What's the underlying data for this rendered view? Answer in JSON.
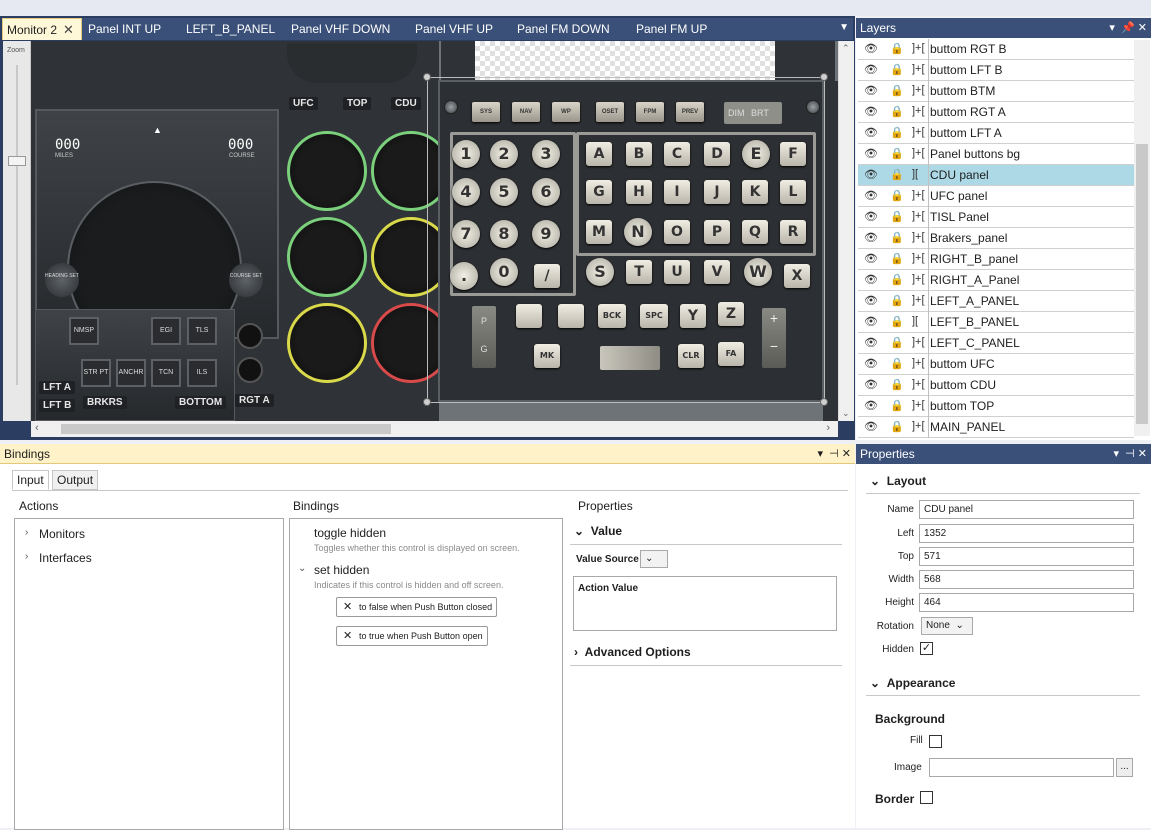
{
  "doc_tabs": {
    "monitor2": "Monitor 2",
    "panel_int_up": "Panel INT UP",
    "left_b_panel": "LEFT_B_PANEL",
    "panel_vhf_down": "Panel VHF DOWN",
    "panel_vhf_up": "Panel VHF UP",
    "panel_fm_down": "Panel FM DOWN",
    "panel_fm_up": "Panel FM UP"
  },
  "canvas": {
    "zoom_label": "Zoom",
    "panel_labels": {
      "ufc": "UFC",
      "top": "TOP",
      "cdu": "CDU",
      "lft_a": "LFT A",
      "lft_b": "LFT B",
      "brkrs": "BRKRS",
      "bottom": "BOTTOM",
      "rgt_a": "RGT A"
    },
    "cdu": {
      "function_keys": [
        "SYS",
        "NAV",
        "WP",
        "OSET",
        "FPM",
        "PREV"
      ],
      "dim": "DIM",
      "brt": "BRT",
      "digits": [
        "1",
        "2",
        "3",
        "4",
        "5",
        "6",
        "7",
        "8",
        "9",
        ".",
        "0",
        "/"
      ],
      "letters_row1": [
        "A",
        "B",
        "C",
        "D",
        "E",
        "F"
      ],
      "letters_row2": [
        "G",
        "H",
        "I",
        "J",
        "K",
        "L"
      ],
      "letters_row3": [
        "M",
        "N",
        "O",
        "P",
        "Q",
        "R"
      ],
      "letters_row4": [
        "S",
        "T",
        "U",
        "V",
        "W",
        "X"
      ],
      "bottom_keys": [
        "BCK",
        "SPC",
        "Y",
        "Z"
      ],
      "mk": "MK",
      "clr": "CLR",
      "fa": "FA",
      "plus": "+",
      "minus": "−",
      "p": "P",
      "g": "G"
    },
    "lft_buttons": [
      "NMSP",
      "EGI",
      "TLS",
      "STR PT",
      "ANCHR",
      "TCN",
      "ILS"
    ],
    "hsi": {
      "miles": "000",
      "course": "000",
      "miles_label": "MILES",
      "course_label": "COURSE",
      "heading_set": "HEADING SET",
      "course_set": "COURSE SET"
    }
  },
  "layers": {
    "title": "Layers",
    "items": [
      {
        "name": "buttom  RGT B",
        "selected": false
      },
      {
        "name": "buttom LFT B",
        "selected": false
      },
      {
        "name": "buttom BTM",
        "selected": false
      },
      {
        "name": "buttom  RGT A",
        "selected": false
      },
      {
        "name": "buttom LFT A",
        "selected": false
      },
      {
        "name": "Panel buttons bg",
        "selected": false
      },
      {
        "name": "CDU panel",
        "selected": true
      },
      {
        "name": "UFC panel",
        "selected": false
      },
      {
        "name": "TISL Panel",
        "selected": false
      },
      {
        "name": "Brakers_panel",
        "selected": false
      },
      {
        "name": "RIGHT_B_panel",
        "selected": false
      },
      {
        "name": "RIGHT_A_Panel",
        "selected": false
      },
      {
        "name": "LEFT_A_PANEL",
        "selected": false
      },
      {
        "name": "LEFT_B_PANEL",
        "selected": false
      },
      {
        "name": "LEFT_C_PANEL",
        "selected": false
      },
      {
        "name": "buttom UFC",
        "selected": false
      },
      {
        "name": "buttom CDU",
        "selected": false
      },
      {
        "name": "buttom TOP",
        "selected": false
      },
      {
        "name": "MAIN_PANEL",
        "selected": false
      }
    ]
  },
  "bindings": {
    "title": "Bindings",
    "tab_input": "Input",
    "tab_output": "Output",
    "col_actions": "Actions",
    "col_bindings": "Bindings",
    "col_properties": "Properties",
    "actions": [
      "Monitors",
      "Interfaces"
    ],
    "toggle_hidden": "toggle hidden",
    "toggle_hidden_desc": "Toggles whether this control is displayed on screen.",
    "set_hidden": "set hidden",
    "set_hidden_desc": "Indicates if this control is hidden and off screen.",
    "chip1": "to false when Push Button closed",
    "chip2": "to true when Push Button open",
    "value_section": "Value",
    "value_source": "Value Source",
    "action_value": "Action Value",
    "advanced_options": "Advanced Options"
  },
  "properties": {
    "title": "Properties",
    "layout": "Layout",
    "name_label": "Name",
    "name": "CDU panel",
    "left_label": "Left",
    "left": "1352",
    "top_label": "Top",
    "top": "571",
    "width_label": "Width",
    "width": "568",
    "height_label": "Height",
    "height": "464",
    "rotation_label": "Rotation",
    "rotation": "None",
    "hidden_label": "Hidden",
    "hidden": true,
    "appearance": "Appearance",
    "background": "Background",
    "fill_label": "Fill",
    "image_label": "Image",
    "browse": "...",
    "border": "Border"
  },
  "colors": {
    "chrome_dark": "#2b3e62",
    "tab_active": "#fff8d8",
    "selection": "#add8e6"
  }
}
